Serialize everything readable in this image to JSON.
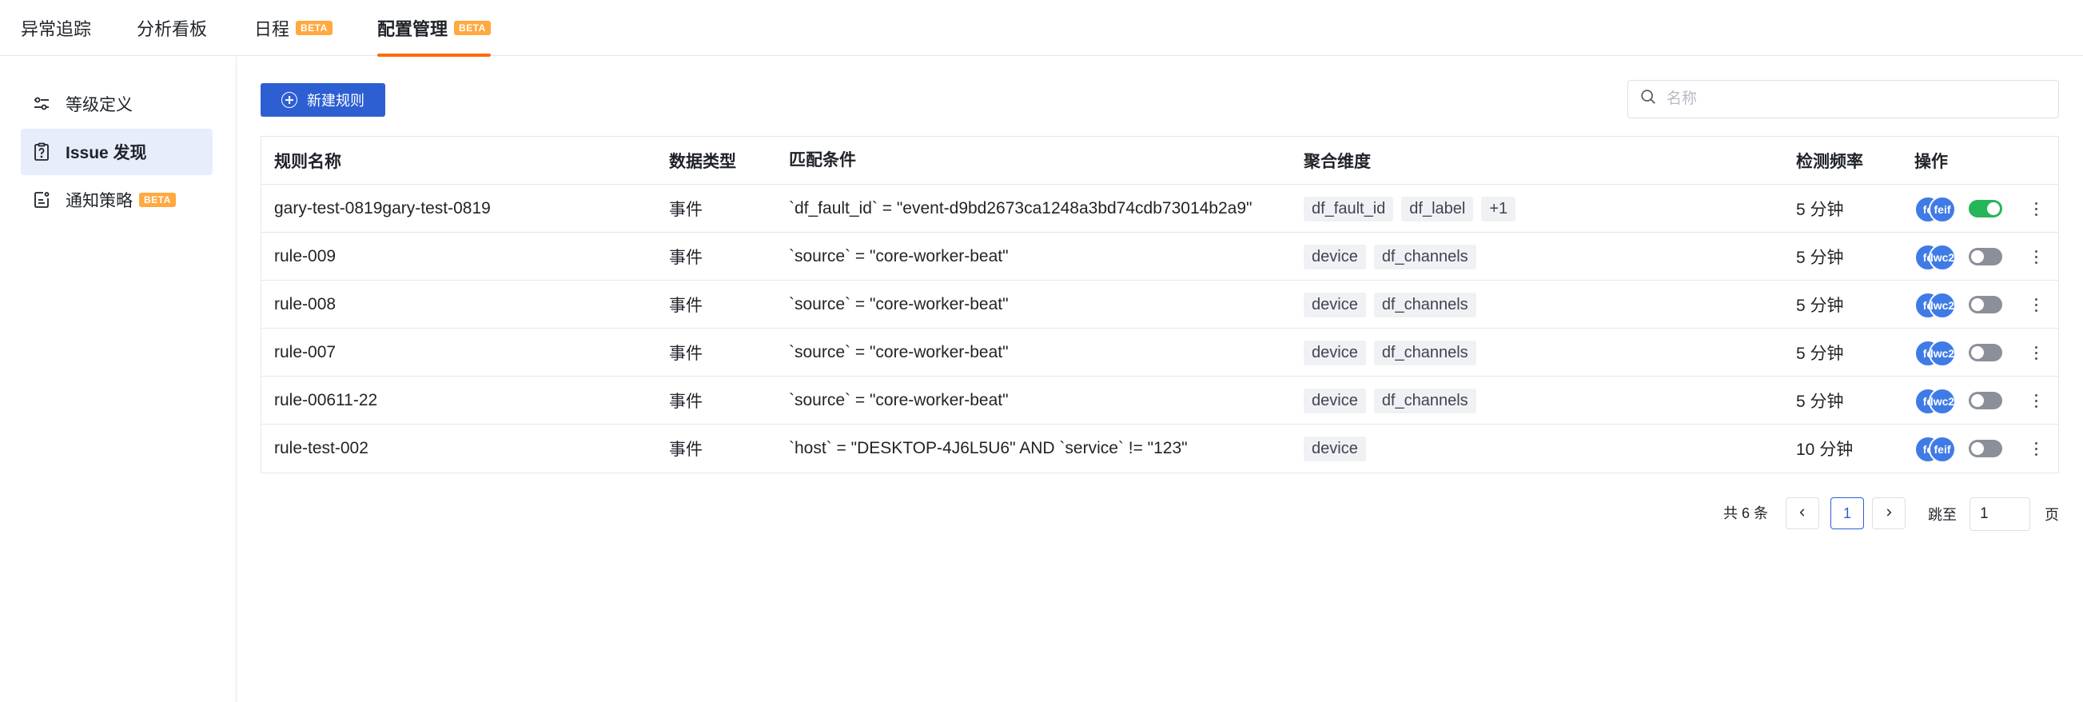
{
  "nav": {
    "tabs": [
      {
        "label": "异常追踪",
        "beta": ""
      },
      {
        "label": "分析看板",
        "beta": ""
      },
      {
        "label": "日程",
        "beta": "BETA"
      },
      {
        "label": "配置管理",
        "beta": "BETA"
      }
    ],
    "active_index": 3,
    "accent_color": "#ff6a00"
  },
  "sidebar": {
    "items": [
      {
        "label": "等级定义",
        "icon": "sliders-icon",
        "beta": ""
      },
      {
        "label": "Issue 发现",
        "icon": "question-doc-icon",
        "beta": ""
      },
      {
        "label": "通知策略",
        "icon": "notice-doc-icon",
        "beta": "BETA"
      }
    ],
    "active_index": 1
  },
  "toolbar": {
    "new_rule_label": "新建规则",
    "search_placeholder": "名称",
    "primary_color": "#2d5fd3"
  },
  "table": {
    "columns": [
      "规则名称",
      "数据类型",
      "匹配条件",
      "聚合维度",
      "检测频率",
      "操作"
    ],
    "rows": [
      {
        "name": "gary-test-0819gary-test-0819",
        "type": "事件",
        "condition": "`df_fault_id` = \"event-d9bd2673ca1248a3bd74cdb73014b2a9\"",
        "dims": [
          "df_fault_id",
          "df_label",
          "+1"
        ],
        "freq": "5 分钟",
        "avatars": [
          "fe",
          "feif"
        ],
        "enabled": true
      },
      {
        "name": "rule-009",
        "type": "事件",
        "condition": "`source` = \"core-worker-beat\"",
        "dims": [
          "device",
          "df_channels"
        ],
        "freq": "5 分钟",
        "avatars": [
          "fe",
          "lwc2"
        ],
        "enabled": false
      },
      {
        "name": "rule-008",
        "type": "事件",
        "condition": "`source` = \"core-worker-beat\"",
        "dims": [
          "device",
          "df_channels"
        ],
        "freq": "5 分钟",
        "avatars": [
          "fe",
          "lwc2"
        ],
        "enabled": false
      },
      {
        "name": "rule-007",
        "type": "事件",
        "condition": "`source` = \"core-worker-beat\"",
        "dims": [
          "device",
          "df_channels"
        ],
        "freq": "5 分钟",
        "avatars": [
          "fe",
          "lwc2"
        ],
        "enabled": false
      },
      {
        "name": "rule-00611-22",
        "type": "事件",
        "condition": "`source` = \"core-worker-beat\"",
        "dims": [
          "device",
          "df_channels"
        ],
        "freq": "5 分钟",
        "avatars": [
          "fe",
          "lwc2"
        ],
        "enabled": false
      },
      {
        "name": "rule-test-002",
        "type": "事件",
        "condition": "`host` = \"DESKTOP-4J6L5U6\" AND `service` != \"123\"",
        "dims": [
          "device"
        ],
        "freq": "10 分钟",
        "avatars": [
          "fe",
          "feif"
        ],
        "enabled": false
      }
    ],
    "toggle_on_color": "#27b55a",
    "toggle_off_color": "#8a8f99"
  },
  "pagination": {
    "total_label": "共 6 条",
    "prev_icon": "chevron-left-icon",
    "next_icon": "chevron-right-icon",
    "current_page": "1",
    "jump_label": "跳至",
    "jump_value": "1",
    "unit_label": "页"
  }
}
